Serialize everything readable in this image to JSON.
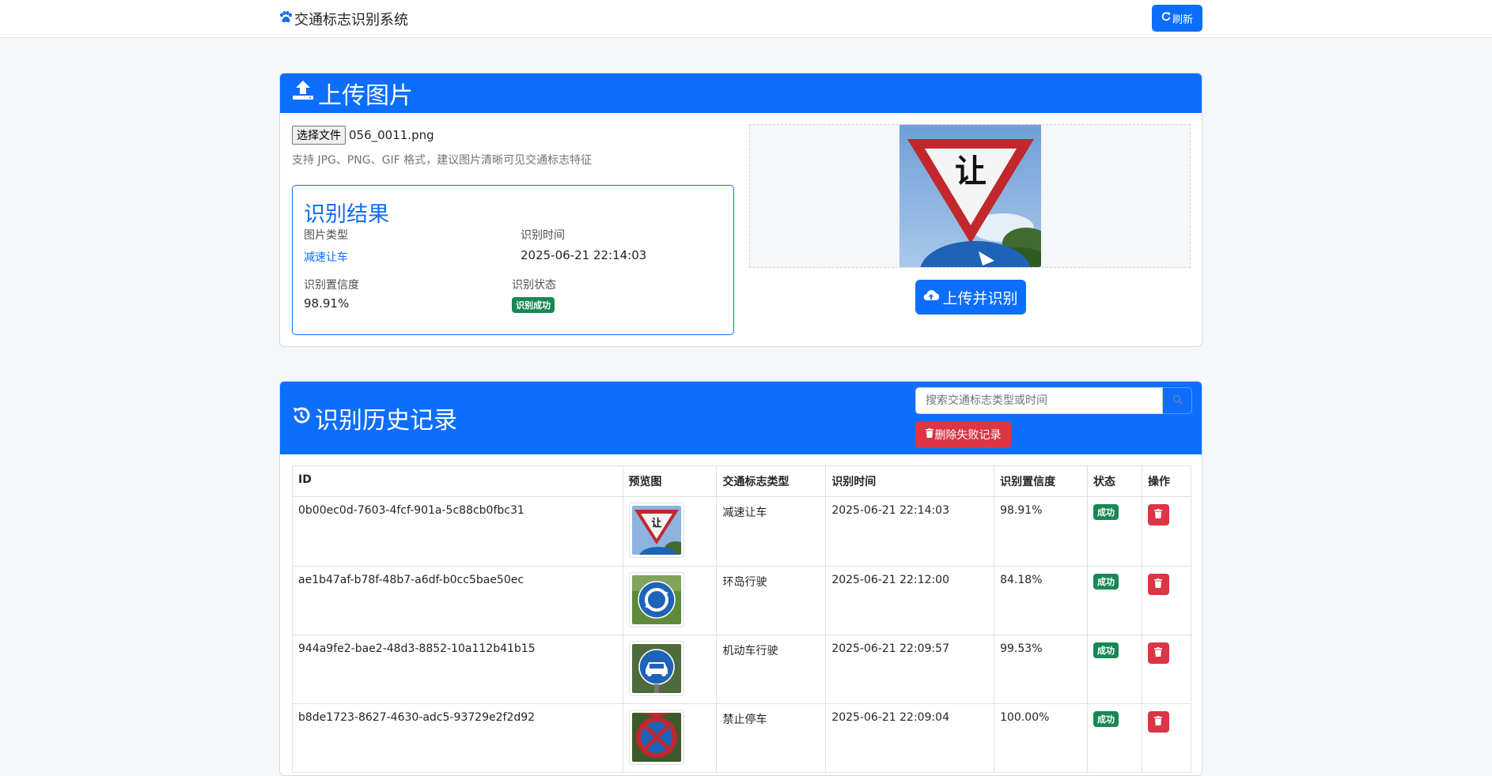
{
  "nav": {
    "brand": "交通标志识别系统",
    "refresh_label": "刷新"
  },
  "upload": {
    "title": "上传图片",
    "file_button": "选择文件",
    "file_name": "056_0011.png",
    "hint": "支持 JPG、PNG、GIF 格式，建议图片清晰可见交通标志特征",
    "submit_label": "上传并识别"
  },
  "result": {
    "title": "识别结果",
    "type_label": "图片类型",
    "type_value": "减速让车",
    "time_label": "识别时间",
    "time_value": "2025-06-21 22:14:03",
    "confidence_label": "识别置信度",
    "confidence_value": "98.91%",
    "status_label": "识别状态",
    "status_value": "识别成功"
  },
  "history": {
    "title": "识别历史记录",
    "search_placeholder": "搜索交通标志类型或时间",
    "delete_failed_label": "删除失败记录",
    "columns": [
      "ID",
      "预览图",
      "交通标志类型",
      "识别时间",
      "识别置信度",
      "状态",
      "操作"
    ],
    "rows": [
      {
        "id": "0b00ec0d-7603-4fcf-901a-5c88cb0fbc31",
        "type": "减速让车",
        "time": "2025-06-21 22:14:03",
        "confidence": "98.91%",
        "status": "成功",
        "thumb": "yield-sign-icon"
      },
      {
        "id": "ae1b47af-b78f-48b7-a6df-b0cc5bae50ec",
        "type": "环岛行驶",
        "time": "2025-06-21 22:12:00",
        "confidence": "84.18%",
        "status": "成功",
        "thumb": "roundabout-sign-icon"
      },
      {
        "id": "944a9fe2-bae2-48d3-8852-10a112b41b15",
        "type": "机动车行驶",
        "time": "2025-06-21 22:09:57",
        "confidence": "99.53%",
        "status": "成功",
        "thumb": "motor-vehicle-sign-icon"
      },
      {
        "id": "b8de1723-8627-4630-adc5-93729e2f2d92",
        "type": "禁止停车",
        "time": "2025-06-21 22:09:04",
        "confidence": "100.00%",
        "status": "成功",
        "thumb": "no-parking-sign-icon"
      }
    ]
  },
  "colors": {
    "primary": "#0d6efd",
    "danger": "#dc3545",
    "success": "#198754"
  }
}
